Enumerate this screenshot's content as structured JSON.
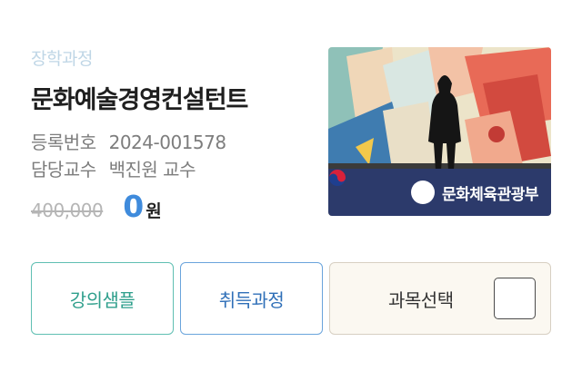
{
  "course": {
    "category": "장학과정",
    "title": "문화예술경영컨설턴트",
    "registration_label": "등록번호",
    "registration_number": "2024-001578",
    "professor_label": "담당교수",
    "professor_name": "백진원 교수",
    "original_price": "400,000",
    "sale_price": "0",
    "currency_unit": "원"
  },
  "thumbnail": {
    "ministry_name": "문화체육관광부",
    "ministry_icon": "taegeuk-icon",
    "bar_color": "#2c3a6b"
  },
  "buttons": {
    "sample_label": "강의샘플",
    "course_label": "취득과정",
    "select_label": "과목선택"
  },
  "colors": {
    "sale_price": "#3f8bdc",
    "sample_border": "#5fbfb2",
    "course_border": "#6aa4dc"
  }
}
